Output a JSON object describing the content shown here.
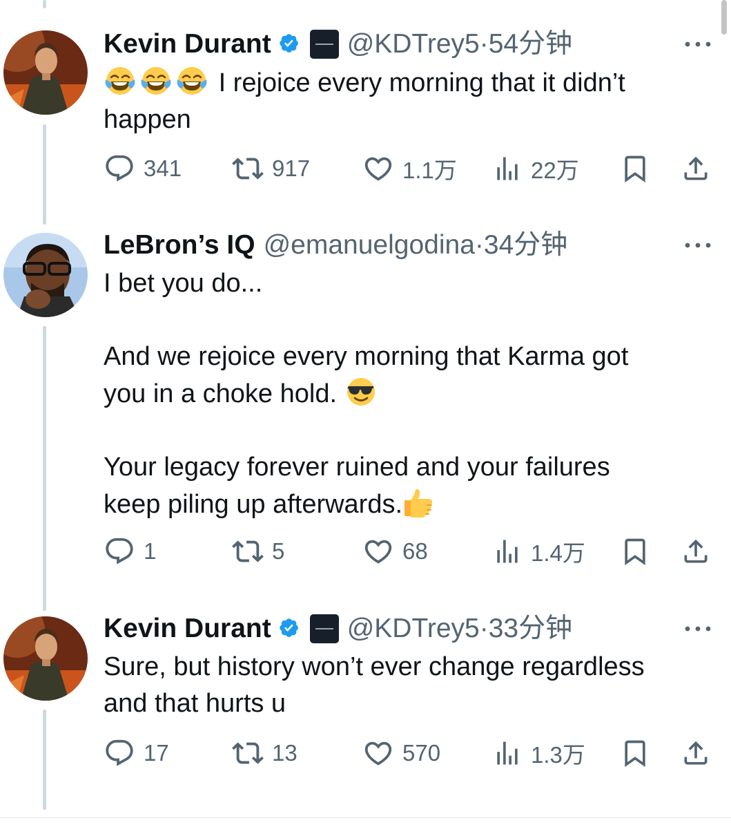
{
  "tweets": [
    {
      "display_name": "Kevin Durant",
      "verified": true,
      "affiliate_badge": "BOARDROOM",
      "handle": "@KDTrey5",
      "separator": "·",
      "time": "54分钟",
      "text": {
        "line1": "I rejoice every morning that it didn’t",
        "line2": "happen"
      },
      "emojis": [
        "joy-emoji",
        "joy-emoji",
        "joy-emoji"
      ],
      "stats": {
        "replies": "341",
        "retweets": "917",
        "likes": "1.1万",
        "views": "22万"
      }
    },
    {
      "display_name": "LeBron’s IQ",
      "verified": false,
      "handle": "@emanuelgodina",
      "separator": "·",
      "time": "34分钟",
      "text": {
        "line1": "I bet you do...",
        "line2": "And we rejoice every morning that Karma got",
        "line3": "you in a choke hold.",
        "line4": "Your legacy forever ruined and your failures",
        "line5": "keep piling up afterwards."
      },
      "emojis": [
        "sunglasses-emoji",
        "thumbs-up-emoji"
      ],
      "stats": {
        "replies": "1",
        "retweets": "5",
        "likes": "68",
        "views": "1.4万"
      }
    },
    {
      "display_name": "Kevin Durant",
      "verified": true,
      "affiliate_badge": "BOARDROOM",
      "handle": "@KDTrey5",
      "separator": "·",
      "time": "33分钟",
      "text": {
        "line1": "Sure, but history won’t ever change regardless",
        "line2": "and that hurts u"
      },
      "stats": {
        "replies": "17",
        "retweets": "13",
        "likes": "570",
        "views": "1.3万"
      }
    }
  ],
  "colors": {
    "text": "#0f1419",
    "secondary": "#536471",
    "verified_blue": "#1d9bf0",
    "thread_line": "#cfd9de"
  },
  "icons": {
    "reply": "speech-bubble-icon",
    "retweet": "retweet-arrows-icon",
    "like": "heart-icon",
    "views": "bar-chart-icon",
    "bookmark": "bookmark-icon",
    "share": "share-upload-icon",
    "more": "ellipsis-icon"
  }
}
